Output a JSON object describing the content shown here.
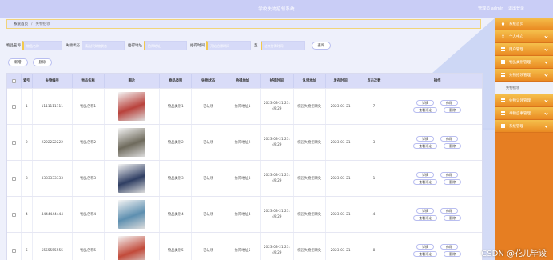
{
  "header": {
    "title": "学校失物招领系统",
    "user_label": "管理员 admin",
    "logout_label": "退出登录"
  },
  "breadcrumb": {
    "home": "系统首页",
    "current": "失物招领"
  },
  "search": {
    "item_name_label": "物品名称",
    "item_name_placeholder": "物品名称",
    "status_label": "失物状态",
    "status_placeholder": "请选择失物状态",
    "place_label": "拾得地址",
    "place_placeholder": "拾得地址",
    "time_label": "拾得时间",
    "time_start_placeholder": "开始拾得时间",
    "time_to": "至",
    "time_end_placeholder": "结束拾得时间",
    "query_button": "查询"
  },
  "actions": {
    "add_button": "新增",
    "delete_button": "删除"
  },
  "table": {
    "headers": [
      "",
      "索引",
      "失物编号",
      "物品名称",
      "图片",
      "物品类别",
      "失物状态",
      "拾得地址",
      "拾得时间",
      "认领地址",
      "发布时间",
      "点击次数",
      "操作"
    ],
    "op_labels": {
      "detail": "详情",
      "edit": "修改",
      "comments": "查看评论",
      "delete": "删除"
    },
    "rows": [
      {
        "index": "1",
        "code": "1111111111",
        "name": "物品名称1",
        "category": "物品类别1",
        "status": "已认领",
        "place": "拾得地址1",
        "date": "2023-03-21 23:",
        "time": "49:29",
        "claim": "校园失物招领处",
        "publish": "2023-03-21",
        "clicks": "7",
        "thumb_color": "#b9423c"
      },
      {
        "index": "2",
        "code": "2222222222",
        "name": "物品名称2",
        "category": "物品类别2",
        "status": "已认领",
        "place": "拾得地址2",
        "date": "2023-03-21 23:",
        "time": "49:29",
        "claim": "校园失物招领处",
        "publish": "2023-03-21",
        "clicks": "3",
        "thumb_color": "#6e6a5c"
      },
      {
        "index": "3",
        "code": "3333333333",
        "name": "物品名称3",
        "category": "物品类别3",
        "status": "已认领",
        "place": "拾得地址3",
        "date": "2023-03-21 23:",
        "time": "49:29",
        "claim": "校园失物招领处",
        "publish": "2023-03-21",
        "clicks": "1",
        "thumb_color": "#2f3e63"
      },
      {
        "index": "4",
        "code": "4444444444",
        "name": "物品名称4",
        "category": "物品类别4",
        "status": "已认领",
        "place": "拾得地址4",
        "date": "2023-03-21 23:",
        "time": "49:29",
        "claim": "校园失物招领处",
        "publish": "2023-03-21",
        "clicks": "4",
        "thumb_color": "#5d8fb0"
      },
      {
        "index": "5",
        "code": "5555555555",
        "name": "物品名称5",
        "category": "物品类别5",
        "status": "已认领",
        "place": "拾得地址5",
        "date": "2023-03-21 23:",
        "time": "49:29",
        "claim": "校园失物招领处",
        "publish": "2023-03-21",
        "clicks": "8",
        "thumb_color": "#c24a3a"
      }
    ]
  },
  "sidebar": {
    "items": [
      {
        "label": "系统首页",
        "icon": "home-icon"
      },
      {
        "label": "个人中心",
        "icon": "user-icon"
      },
      {
        "label": "用户管理",
        "icon": "grid-icon"
      },
      {
        "label": "物品类别管理",
        "icon": "grid-icon"
      },
      {
        "label": "失物招领管理",
        "icon": "grid-icon"
      }
    ],
    "sub_item": "失物招领",
    "items_after": [
      {
        "label": "失物认领管理",
        "icon": "grid-icon"
      },
      {
        "label": "寻物启事管理",
        "icon": "grid-icon"
      },
      {
        "label": "系统管理",
        "icon": "grid-icon"
      }
    ]
  },
  "watermark": "CSDN @花儿毕设"
}
